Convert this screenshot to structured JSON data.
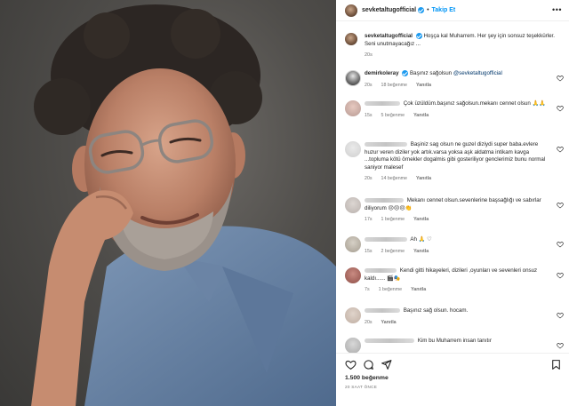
{
  "post": {
    "username": "sevketaltugofficial",
    "follow_label": "Takip Et",
    "more_label": "•••",
    "caption_text": "Hoşça kal Muharrem. Her şey için sonsuz teşekkürler. Seni unutmayacağız ...",
    "caption_time": "20s"
  },
  "comments": [
    {
      "username": "demirkoleray",
      "text": "Başınız sağolsun",
      "mention": "@sevketaltugofficial",
      "time": "20s",
      "likes": "18 beğenme",
      "reply": "Yanıtla"
    },
    {
      "text": "Çok üzüldüm.başınız sağolsun.mekanı cennet olsun 🙏🙏",
      "time": "15s",
      "likes": "5 beğenme",
      "reply": "Yanıtla"
    },
    {
      "text": "Başiniz sag olsun ne guzel diziydi super baba.evlere huzur veren diziler yok artık.varsa yoksa aşk aldatma intikam kavga ...topluma kötü örnekler dogalmis gibi gosteriliyor genclerimiz bunu normal saniyor malesef",
      "time": "20s",
      "likes": "14 beğenme",
      "reply": "Yanıtla"
    },
    {
      "text": "Mekanı cennet olsun.sevenlerine başsağlığı ve sabırlar diliyorum 😔😔😔👏",
      "time": "17s",
      "likes": "1 beğenme",
      "reply": "Yanıtla"
    },
    {
      "text": "Ah 🙏 ♡",
      "time": "15s",
      "likes": "2 beğenme",
      "reply": "Yanıtla"
    },
    {
      "text": "Kendi gitti hikayeleri, dizileri ,oyunları ve sevenleri onsuz kaldı...... 🎬🎭",
      "time": "7s",
      "likes": "1 beğenme",
      "reply": "Yanıtla"
    },
    {
      "text": "Başınız sağ olsun. hocam.",
      "time": "20s",
      "reply": "Yanıtla"
    },
    {
      "text": "Kim bu Muharrem insan tanıtır"
    }
  ],
  "footer": {
    "likes": "1.500 beğenme",
    "time_ago": "20 SAAT ÖNCE"
  },
  "icons": {
    "like": "heart-icon",
    "comment": "comment-icon",
    "share": "send-icon",
    "save": "bookmark-icon"
  },
  "colors": {
    "accent": "#0095f6",
    "verified": "#1d9bf0",
    "mention": "#00376b",
    "muted": "#737373"
  }
}
